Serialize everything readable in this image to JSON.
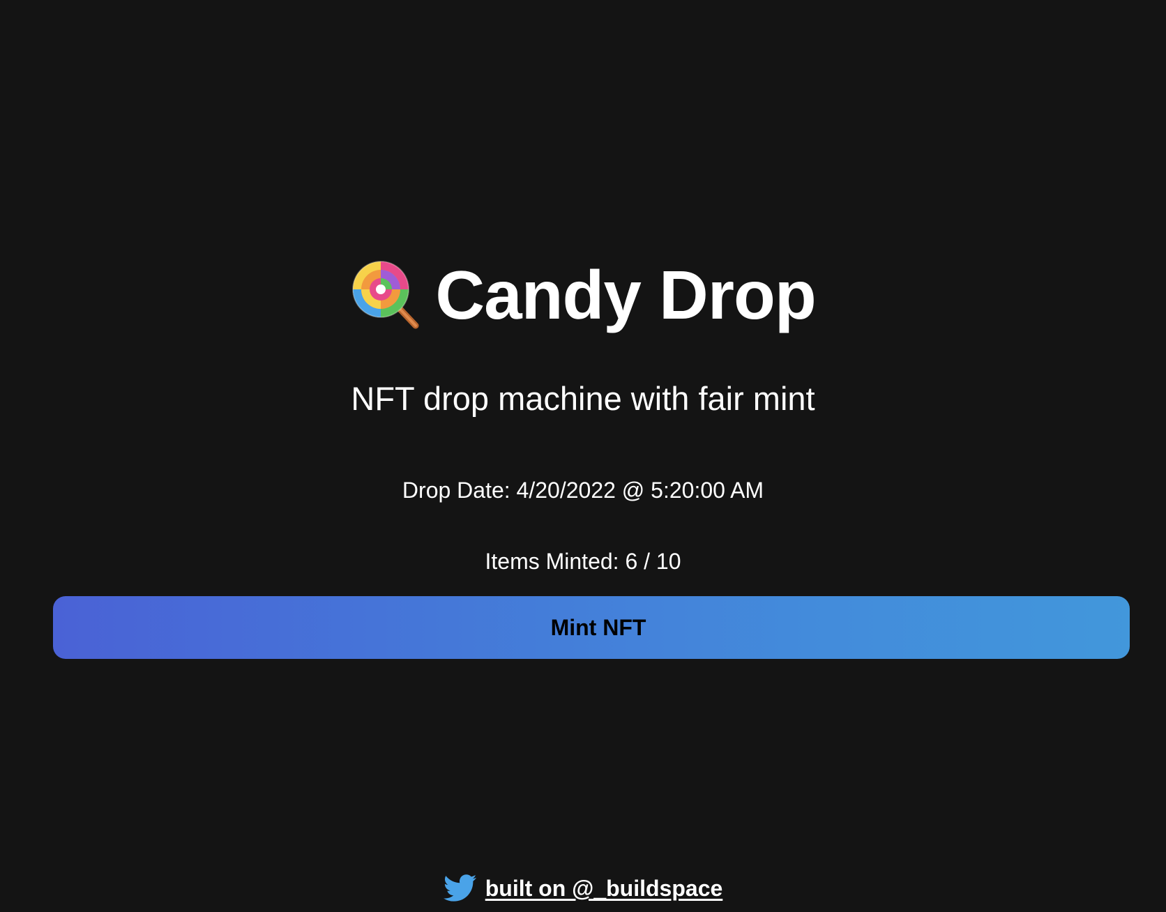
{
  "header": {
    "icon": "lollipop-icon",
    "title": "Candy Drop",
    "subtitle": "NFT drop machine with fair mint"
  },
  "mint_info": {
    "drop_date": "Drop Date: 4/20/2022 @ 5:20:00 AM",
    "items_minted": "Items Minted: 6 / 10"
  },
  "actions": {
    "mint_label": "Mint NFT"
  },
  "footer": {
    "icon": "twitter-icon",
    "link_text": "built on @_buildspace"
  },
  "colors": {
    "background": "#141414",
    "text": "#ffffff",
    "button_gradient_start": "#4a62d6",
    "button_gradient_end": "#4297db",
    "twitter_blue": "#4aa3e8"
  }
}
